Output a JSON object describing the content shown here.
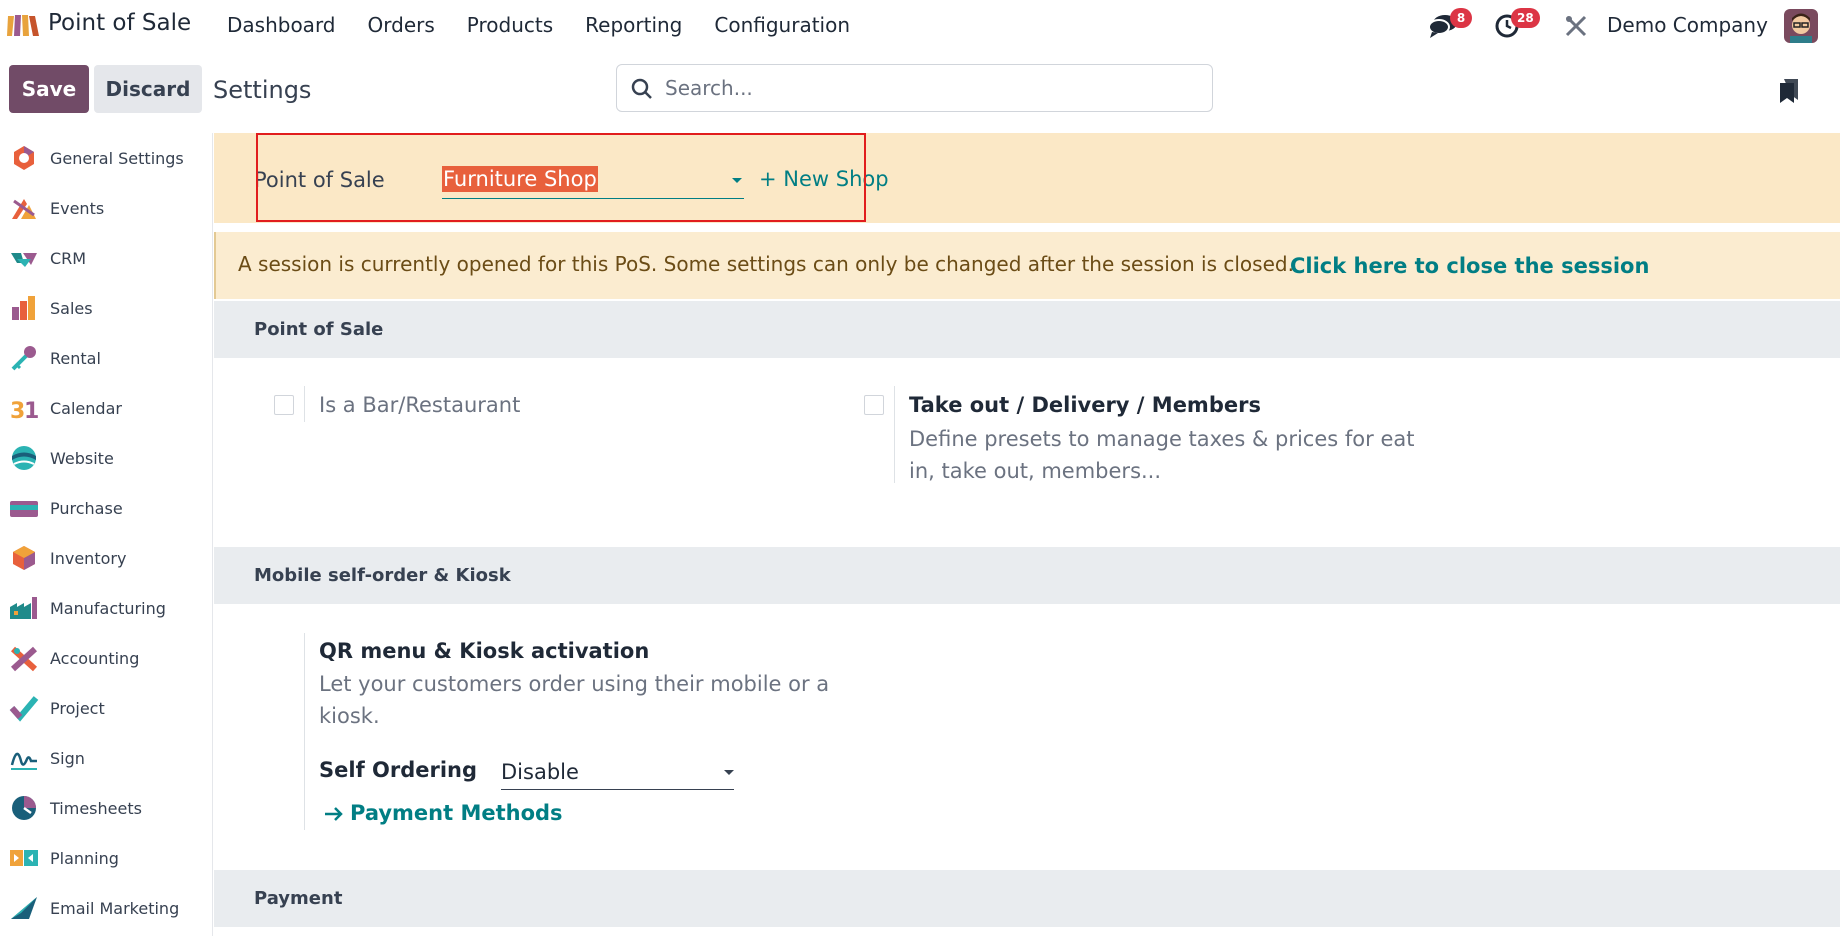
{
  "navbar": {
    "app_name": "Point of Sale",
    "menu": [
      "Dashboard",
      "Orders",
      "Products",
      "Reporting",
      "Configuration"
    ],
    "messages_count": "8",
    "activities_count": "28",
    "company": "Demo Company"
  },
  "control": {
    "save_label": "Save",
    "discard_label": "Discard",
    "title": "Settings",
    "search_placeholder": "Search..."
  },
  "sidebar": {
    "items": [
      {
        "label": "General Settings",
        "icon": "general-settings-icon"
      },
      {
        "label": "Events",
        "icon": "events-icon"
      },
      {
        "label": "CRM",
        "icon": "crm-icon"
      },
      {
        "label": "Sales",
        "icon": "sales-icon"
      },
      {
        "label": "Rental",
        "icon": "rental-icon"
      },
      {
        "label": "Calendar",
        "icon": "calendar-icon"
      },
      {
        "label": "Website",
        "icon": "website-icon"
      },
      {
        "label": "Purchase",
        "icon": "purchase-icon"
      },
      {
        "label": "Inventory",
        "icon": "inventory-icon"
      },
      {
        "label": "Manufacturing",
        "icon": "manufacturing-icon"
      },
      {
        "label": "Accounting",
        "icon": "accounting-icon"
      },
      {
        "label": "Project",
        "icon": "project-icon"
      },
      {
        "label": "Sign",
        "icon": "sign-icon"
      },
      {
        "label": "Timesheets",
        "icon": "timesheets-icon"
      },
      {
        "label": "Planning",
        "icon": "planning-icon"
      },
      {
        "label": "Email Marketing",
        "icon": "email-marketing-icon"
      }
    ]
  },
  "pos_bar": {
    "label": "Point of Sale",
    "selected_shop": "Furniture Shop",
    "new_shop": "+ New Shop"
  },
  "alert": {
    "text": "A session is currently opened for this PoS. Some settings can only be changed after the session is closed.",
    "link": "Click here to close the session"
  },
  "sections": {
    "pos": {
      "title": "Point of Sale",
      "bar_restaurant": "Is a Bar/Restaurant",
      "takeout_title": "Take out / Delivery / Members",
      "takeout_desc": "Define presets to manage taxes & prices for eat in, take out, members..."
    },
    "mobile": {
      "title": "Mobile self-order & Kiosk",
      "qr_title": "QR menu & Kiosk activation",
      "qr_desc": "Let your customers order using their mobile or a kiosk.",
      "self_ordering_label": "Self Ordering",
      "self_ordering_value": "Disable",
      "payment_methods": "Payment Methods"
    },
    "payment": {
      "title": "Payment"
    }
  },
  "colors": {
    "brand": "#714b67",
    "link": "#017e84",
    "badge": "#dc3545",
    "highlight_selection": "#e8603c"
  }
}
